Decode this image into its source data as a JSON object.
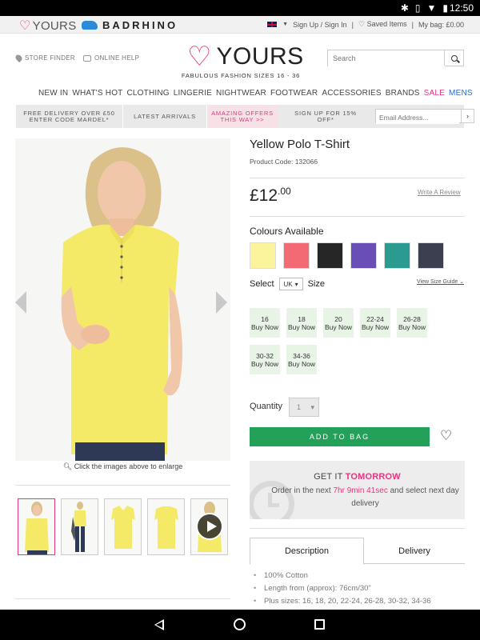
{
  "status_bar": {
    "time": "12:50"
  },
  "brand_bar": {
    "yours_label": "YOURS",
    "badrhino_label": "BADRHINO",
    "sign_in": "Sign Up / Sign In",
    "saved_items": "Saved Items",
    "my_bag": "My bag: £0.00"
  },
  "header": {
    "store_finder": "STORE FINDER",
    "online_help": "ONLINE HELP",
    "logo_text": "YOURS",
    "tagline": "FABULOUS FASHION SIZES 16 - 36",
    "search_placeholder": "Search"
  },
  "nav": {
    "items": [
      "NEW IN",
      "WHAT'S HOT",
      "CLOTHING",
      "LINGERIE",
      "NIGHTWEAR",
      "FOOTWEAR",
      "ACCESSORIES",
      "BRANDS"
    ],
    "sale": "SALE",
    "mens": "MENS"
  },
  "promo_bar": {
    "delivery_line1": "FREE DELIVERY OVER £50",
    "delivery_line2": "ENTER CODE MARDEL*",
    "latest": "LATEST ARRIVALS",
    "offers_line1": "AMAZING OFFERS",
    "offers_line2": "THIS WAY >>",
    "signup_line1": "SIGN UP FOR 15%",
    "signup_line2": "OFF*",
    "email_placeholder": "Email Address..."
  },
  "gallery": {
    "enlarge_text": "Click the images above to enlarge"
  },
  "product": {
    "title": "Yellow Polo T-Shirt",
    "code": "Product Code: 132066",
    "price_main": "£12",
    "price_cents": ".00",
    "write_review": "Write A Review",
    "colours_heading": "Colours Available",
    "colours": [
      "#fbf49c",
      "#f26a73",
      "#262626",
      "#6a4eb8",
      "#2a9b8e",
      "#3b3f4f"
    ],
    "select_label": "Select",
    "region": "UK",
    "size_label": "Size",
    "size_guide": "View Size Guide",
    "sizes": [
      {
        "size": "16",
        "status": "Buy Now"
      },
      {
        "size": "18",
        "status": "Buy Now"
      },
      {
        "size": "20",
        "status": "Buy Now"
      },
      {
        "size": "22-24",
        "status": "Buy Now"
      },
      {
        "size": "26-28",
        "status": "Buy Now"
      },
      {
        "size": "30-32",
        "status": "Buy Now"
      },
      {
        "size": "34-36",
        "status": "Buy Now"
      }
    ],
    "quantity_label": "Quantity",
    "quantity_value": "1",
    "add_to_bag": "ADD TO BAG"
  },
  "delivery": {
    "get_it": "GET IT",
    "tomorrow": "TOMORROW",
    "order_prefix": "Order in the next",
    "countdown": "7hr 9min 41sec",
    "order_suffix": "and select next day delivery"
  },
  "tabs": {
    "description": "Description",
    "delivery": "Delivery"
  },
  "description_points": [
    "100% Cotton",
    "Length from (approx): 76cm/30\"",
    "Plus sizes: 16, 18, 20, 22-24, 26-28, 30-32, 34-36"
  ],
  "colors": {
    "brand_pink": "#e8357f",
    "add_to_bag_green": "#24a159",
    "size_box_bg": "#e8f4e6"
  }
}
